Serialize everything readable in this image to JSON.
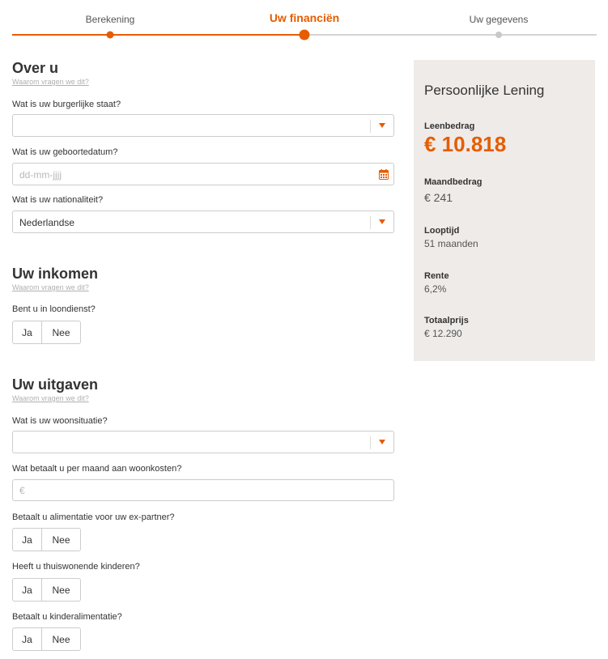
{
  "stepper": {
    "steps": [
      {
        "label": "Berekening",
        "state": "done"
      },
      {
        "label": "Uw financiën",
        "state": "active"
      },
      {
        "label": "Uw gegevens",
        "state": "todo"
      }
    ]
  },
  "colors": {
    "accent": "#e65c00",
    "panel": "#efebe8"
  },
  "sections": {
    "over_u": {
      "title": "Over u",
      "why": "Waarom vragen we dit?",
      "marital_label": "Wat is uw burgerlijke staat?",
      "marital_value": "",
      "birth_label": "Wat is uw geboortedatum?",
      "birth_placeholder": "dd-mm-jjjj",
      "nationality_label": "Wat is uw nationaliteit?",
      "nationality_value": "Nederlandse"
    },
    "inkomen": {
      "title": "Uw inkomen",
      "why": "Waarom vragen we dit?",
      "employed_label": "Bent u in loondienst?"
    },
    "uitgaven": {
      "title": "Uw uitgaven",
      "why": "Waarom vragen we dit?",
      "housing_label": "Wat is uw woonsituatie?",
      "housing_value": "",
      "costs_label": "Wat betaalt u per maand aan woonkosten?",
      "costs_placeholder": "€",
      "alimony_label": "Betaalt u alimentatie voor uw ex-partner?",
      "children_label": "Heeft u thuiswonende kinderen?",
      "child_alimony_label": "Betaalt u kinderalimentatie?"
    }
  },
  "toggle": {
    "yes": "Ja",
    "no": "Nee"
  },
  "summary": {
    "title": "Persoonlijke Lening",
    "loan_label": "Leenbedrag",
    "loan_value": "€ 10.818",
    "monthly_label": "Maandbedrag",
    "monthly_value": "€ 241",
    "term_label": "Looptijd",
    "term_value": "51 maanden",
    "rate_label": "Rente",
    "rate_value": "6,2%",
    "total_label": "Totaalprijs",
    "total_value": "€ 12.290"
  },
  "icons": {
    "select": "chevron-down-icon",
    "date": "calendar-icon"
  }
}
